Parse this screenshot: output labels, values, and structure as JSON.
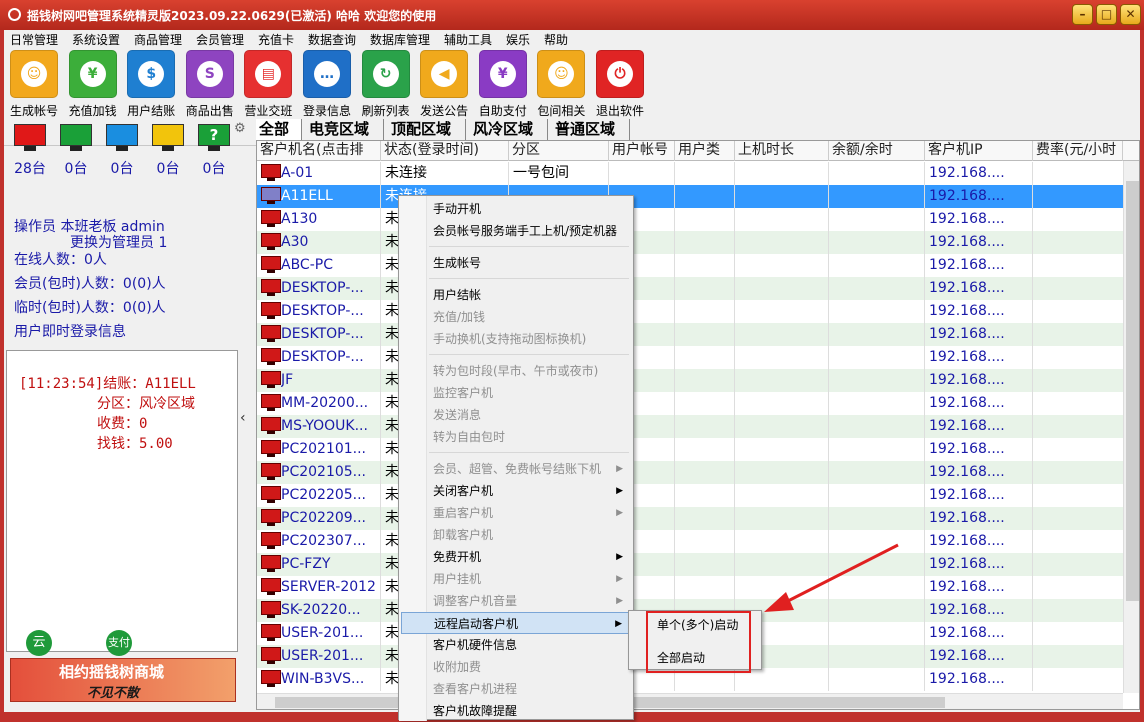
{
  "window": {
    "title": "摇钱树网吧管理系统精灵版2023.09.22.0629(已激活)  哈哈 欢迎您的使用"
  },
  "menu": [
    "日常管理",
    "系统设置",
    "商品管理",
    "会员管理",
    "充值卡",
    "数据查询",
    "数据库管理",
    "辅助工具",
    "娱乐",
    "帮助"
  ],
  "toolbar": [
    {
      "label": "生成帐号",
      "icon": "user-icon",
      "color": "#f2a81d"
    },
    {
      "label": "充值加钱",
      "icon": "money-bag-icon",
      "color": "#3cae3a"
    },
    {
      "label": "用户结账",
      "icon": "dollar-card-icon",
      "color": "#1f7fd1"
    },
    {
      "label": "商品出售",
      "icon": "sale-tag-icon",
      "color": "#8e44c0"
    },
    {
      "label": "营业交班",
      "icon": "shop-icon",
      "color": "#e63030"
    },
    {
      "label": "登录信息",
      "icon": "chat-icon",
      "color": "#1f6fc7"
    },
    {
      "label": "刷新列表",
      "icon": "refresh-icon",
      "color": "#2aa24a"
    },
    {
      "label": "发送公告",
      "icon": "megaphone-icon",
      "color": "#f0a91c"
    },
    {
      "label": "自助支付",
      "icon": "yen-icon",
      "color": "#8a3bc4"
    },
    {
      "label": "包间相关",
      "icon": "person-icon",
      "color": "#f0a91c"
    },
    {
      "label": "退出软件",
      "icon": "power-icon",
      "color": "#e02424"
    }
  ],
  "status_monitors": [
    {
      "color": "#e01818",
      "count": "28台"
    },
    {
      "color": "#1aa038",
      "count": "0台"
    },
    {
      "color": "#1a8ee0",
      "count": "0台"
    },
    {
      "color": "#f2c40c",
      "count": "0台"
    },
    {
      "color": "#1aa038",
      "count": "0台",
      "symbol": "?"
    }
  ],
  "operator": {
    "line1": "操作员 本班老板 admin",
    "line2": "更换为管理员 1",
    "online": "在线人数：0人",
    "member": "会员(包时)人数：0(0)人",
    "temp": "临时(包时)人数：0(0)人",
    "login_info": "用户即时登录信息"
  },
  "log": {
    "l1": "[11:23:54]结账：A11ELL",
    "l2": "分区：风冷区域",
    "l3": "收费：0",
    "l4": "找钱：5.00"
  },
  "bottom_icons": {
    "cloud": "云",
    "pay": "支付"
  },
  "banner": {
    "line1": "相约摇钱树商城",
    "line2": "不见不散"
  },
  "tabs": [
    "全部",
    "电竞区域",
    "顶配区域",
    "风冷区域",
    "普通区域"
  ],
  "columns": [
    "客户机名(点击排",
    "状态(登录时间)",
    "分区",
    "用户帐号",
    "用户类",
    "上机时长",
    "余额/余时",
    "客户机IP",
    "费率(元/小时"
  ],
  "rows": [
    {
      "name": "A-01",
      "status": "未连接",
      "zone": "一号包间",
      "ip": "192.168...."
    },
    {
      "name": "A11ELL",
      "status": "未连接",
      "zone": "",
      "ip": "192.168...."
    },
    {
      "name": "A130",
      "status": "未",
      "zone": "",
      "ip": "192.168...."
    },
    {
      "name": "A30",
      "status": "未",
      "zone": "",
      "ip": "192.168...."
    },
    {
      "name": "ABC-PC",
      "status": "未",
      "zone": "",
      "ip": "192.168...."
    },
    {
      "name": "DESKTOP-...",
      "status": "未",
      "zone": "",
      "ip": "192.168...."
    },
    {
      "name": "DESKTOP-...",
      "status": "未",
      "zone": "",
      "ip": "192.168...."
    },
    {
      "name": "DESKTOP-...",
      "status": "未",
      "zone": "",
      "ip": "192.168...."
    },
    {
      "name": "DESKTOP-...",
      "status": "未",
      "zone": "",
      "ip": "192.168...."
    },
    {
      "name": "JF",
      "status": "未",
      "zone": "",
      "ip": "192.168...."
    },
    {
      "name": "MM-20200...",
      "status": "未",
      "zone": "",
      "ip": "192.168...."
    },
    {
      "name": "MS-YOOUK...",
      "status": "未",
      "zone": "",
      "ip": "192.168...."
    },
    {
      "name": "PC202101...",
      "status": "未",
      "zone": "",
      "ip": "192.168...."
    },
    {
      "name": "PC202105...",
      "status": "未",
      "zone": "",
      "ip": "192.168...."
    },
    {
      "name": "PC202205...",
      "status": "未",
      "zone": "",
      "ip": "192.168...."
    },
    {
      "name": "PC202209...",
      "status": "未",
      "zone": "",
      "ip": "192.168...."
    },
    {
      "name": "PC202307...",
      "status": "未",
      "zone": "",
      "ip": "192.168...."
    },
    {
      "name": "PC-FZY",
      "status": "未",
      "zone": "",
      "ip": "192.168...."
    },
    {
      "name": "SERVER-2012",
      "status": "未",
      "zone": "",
      "ip": "192.168...."
    },
    {
      "name": "SK-20220...",
      "status": "未",
      "zone": "",
      "ip": "192.168...."
    },
    {
      "name": "USER-201...",
      "status": "未",
      "zone": "",
      "ip": "192.168...."
    },
    {
      "name": "USER-201...",
      "status": "未",
      "zone": "",
      "ip": "192.168...."
    },
    {
      "name": "WIN-B3VS...",
      "status": "未",
      "zone": "",
      "ip": "192.168...."
    }
  ],
  "context_menu": [
    {
      "label": "手动开机",
      "disabled": false
    },
    {
      "label": "会员帐号服务端手工上机/预定机器",
      "disabled": false
    },
    {
      "sep": true
    },
    {
      "label": "生成帐号",
      "disabled": false
    },
    {
      "sep": true
    },
    {
      "label": "用户结帐",
      "disabled": false
    },
    {
      "label": "充值/加钱",
      "disabled": true
    },
    {
      "label": "手动换机(支持拖动图标换机)",
      "disabled": true
    },
    {
      "sep": true
    },
    {
      "label": "转为包时段(早市、午市或夜市)",
      "disabled": true
    },
    {
      "label": "监控客户机",
      "disabled": true
    },
    {
      "label": "发送消息",
      "disabled": true
    },
    {
      "label": "转为自由包时",
      "disabled": true
    },
    {
      "sep": true
    },
    {
      "label": "会员、超管、免费帐号结账下机",
      "disabled": true,
      "sub": true
    },
    {
      "label": "关闭客户机",
      "disabled": false,
      "sub": true
    },
    {
      "label": "重启客户机",
      "disabled": true,
      "sub": true
    },
    {
      "label": "卸载客户机",
      "disabled": true
    },
    {
      "label": "免费开机",
      "disabled": false,
      "sub": true
    },
    {
      "label": "用户挂机",
      "disabled": true,
      "sub": true
    },
    {
      "label": "调整客户机音量",
      "disabled": true,
      "sub": true
    },
    {
      "label": "远程启动客户机",
      "disabled": false,
      "sub": true,
      "highlight": true
    },
    {
      "label": "客户机硬件信息",
      "disabled": false
    },
    {
      "label": "收附加费",
      "disabled": true
    },
    {
      "label": "查看客户机进程",
      "disabled": true
    },
    {
      "label": "客户机故障提醒",
      "disabled": false
    }
  ],
  "submenu": [
    "单个(多个)启动",
    "全部启动"
  ],
  "colors": {
    "title_bg": "#c0312c",
    "selection": "#3399ff",
    "annotation": "#e02020",
    "text_blue": "#1a1aa8",
    "log_red": "#c01010"
  }
}
